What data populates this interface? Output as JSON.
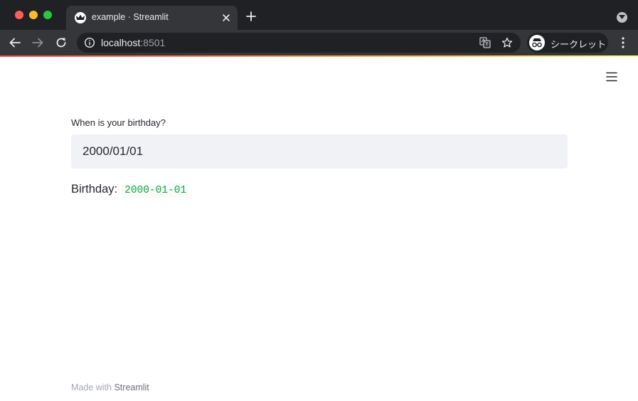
{
  "browser": {
    "tab_title": "example · Streamlit",
    "url_host": "localhost",
    "url_port": ":8501",
    "incognito_label": "シークレット"
  },
  "app": {
    "date_label": "When is your birthday?",
    "date_value": "2000/01/01",
    "result_label": "Birthday:",
    "result_value": "2000-01-01",
    "footer_prefix": "Made with",
    "footer_link": "Streamlit"
  },
  "colors": {
    "chrome_dark": "#202124",
    "chrome_tab": "#35363a",
    "input_bg": "#f0f2f6",
    "code_green": "#09ab3b",
    "text": "#262730"
  },
  "icons": [
    "back-icon",
    "forward-icon",
    "reload-icon",
    "info-icon",
    "translate-icon",
    "star-icon",
    "incognito-icon",
    "more-icon",
    "hamburger-menu-icon",
    "close-icon",
    "plus-icon"
  ]
}
